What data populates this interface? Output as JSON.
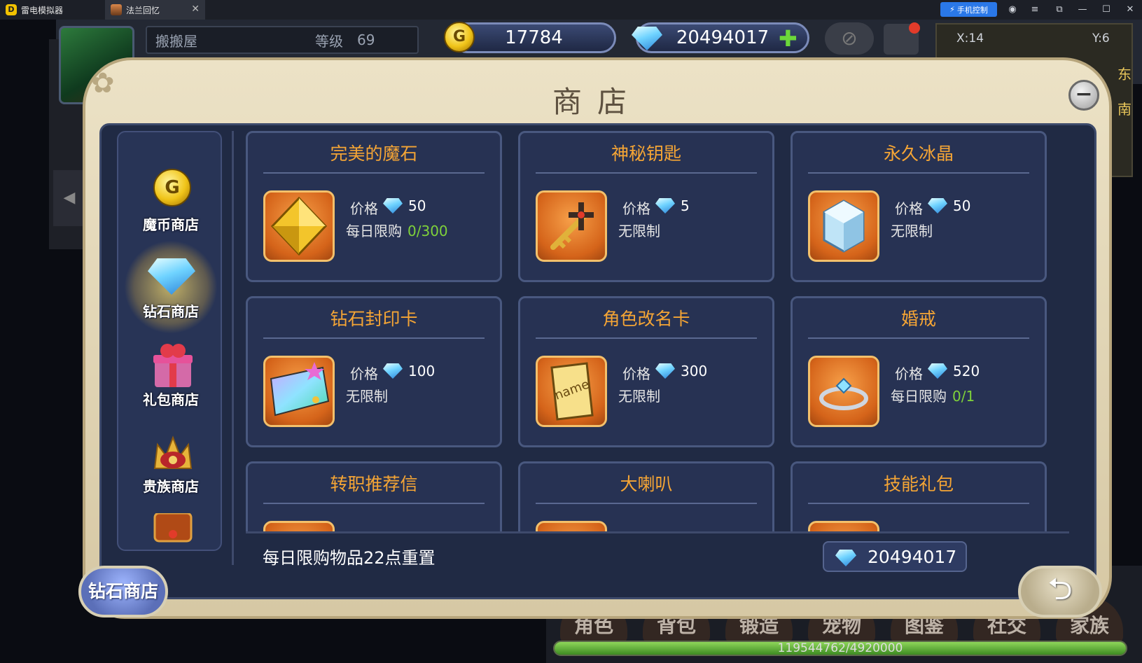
{
  "window": {
    "tabs": [
      {
        "label": "雷电模拟器"
      },
      {
        "label": "法兰回忆"
      }
    ],
    "phone_control": "手机控制"
  },
  "hud": {
    "player_name": "搬搬屋",
    "level_label": "等级",
    "level_value": "69",
    "gold": "17784",
    "diamonds": "20494017",
    "coord_x": "X:14",
    "coord_y": "Y:6",
    "dir_east": "东",
    "dir_south": "南"
  },
  "shop": {
    "title": "商店",
    "categories": [
      {
        "label": "魔币商店",
        "icon": "gold-coin-icon"
      },
      {
        "label": "钻石商店",
        "icon": "diamond-icon",
        "selected": true
      },
      {
        "label": "礼包商店",
        "icon": "gift-icon"
      },
      {
        "label": "贵族商店",
        "icon": "crown-icon"
      }
    ],
    "price_label": "价格",
    "items": [
      {
        "name": "完美的魔石",
        "price": "50",
        "limit_text": "每日限购",
        "limit_count": "0/300",
        "icon": "magic-stone-icon"
      },
      {
        "name": "神秘钥匙",
        "price": "5",
        "limit_text": "无限制",
        "limit_count": "",
        "icon": "key-icon"
      },
      {
        "name": "永久冰晶",
        "price": "50",
        "limit_text": "无限制",
        "limit_count": "",
        "icon": "ice-crystal-icon"
      },
      {
        "name": "钻石封印卡",
        "price": "100",
        "limit_text": "无限制",
        "limit_count": "",
        "icon": "seal-card-icon"
      },
      {
        "name": "角色改名卡",
        "price": "300",
        "limit_text": "无限制",
        "limit_count": "",
        "icon": "rename-card-icon"
      },
      {
        "name": "婚戒",
        "price": "520",
        "limit_text": "每日限购",
        "limit_count": "0/1",
        "icon": "ring-icon"
      },
      {
        "name": "转职推荐信",
        "price": "",
        "limit_text": "",
        "limit_count": "",
        "icon": ""
      },
      {
        "name": "大喇叭",
        "price": "",
        "limit_text": "",
        "limit_count": "",
        "icon": ""
      },
      {
        "name": "技能礼包",
        "price": "",
        "limit_text": "",
        "limit_count": "",
        "icon": ""
      }
    ],
    "reset_note": "每日限购物品22点重置",
    "balance": "20494017",
    "current_tab": "钻石商店"
  },
  "bottom_nav": [
    "角色",
    "背包",
    "锻造",
    "宠物",
    "图鉴",
    "社交",
    "家族"
  ],
  "exp": {
    "text": "119544762/4920000",
    "fill_fraction": 1.0
  },
  "colors": {
    "title_orange": "#f5a535",
    "limit_green": "#7fd23a",
    "panel_navy": "#202a44",
    "frame_cream": "#ece2c6"
  }
}
